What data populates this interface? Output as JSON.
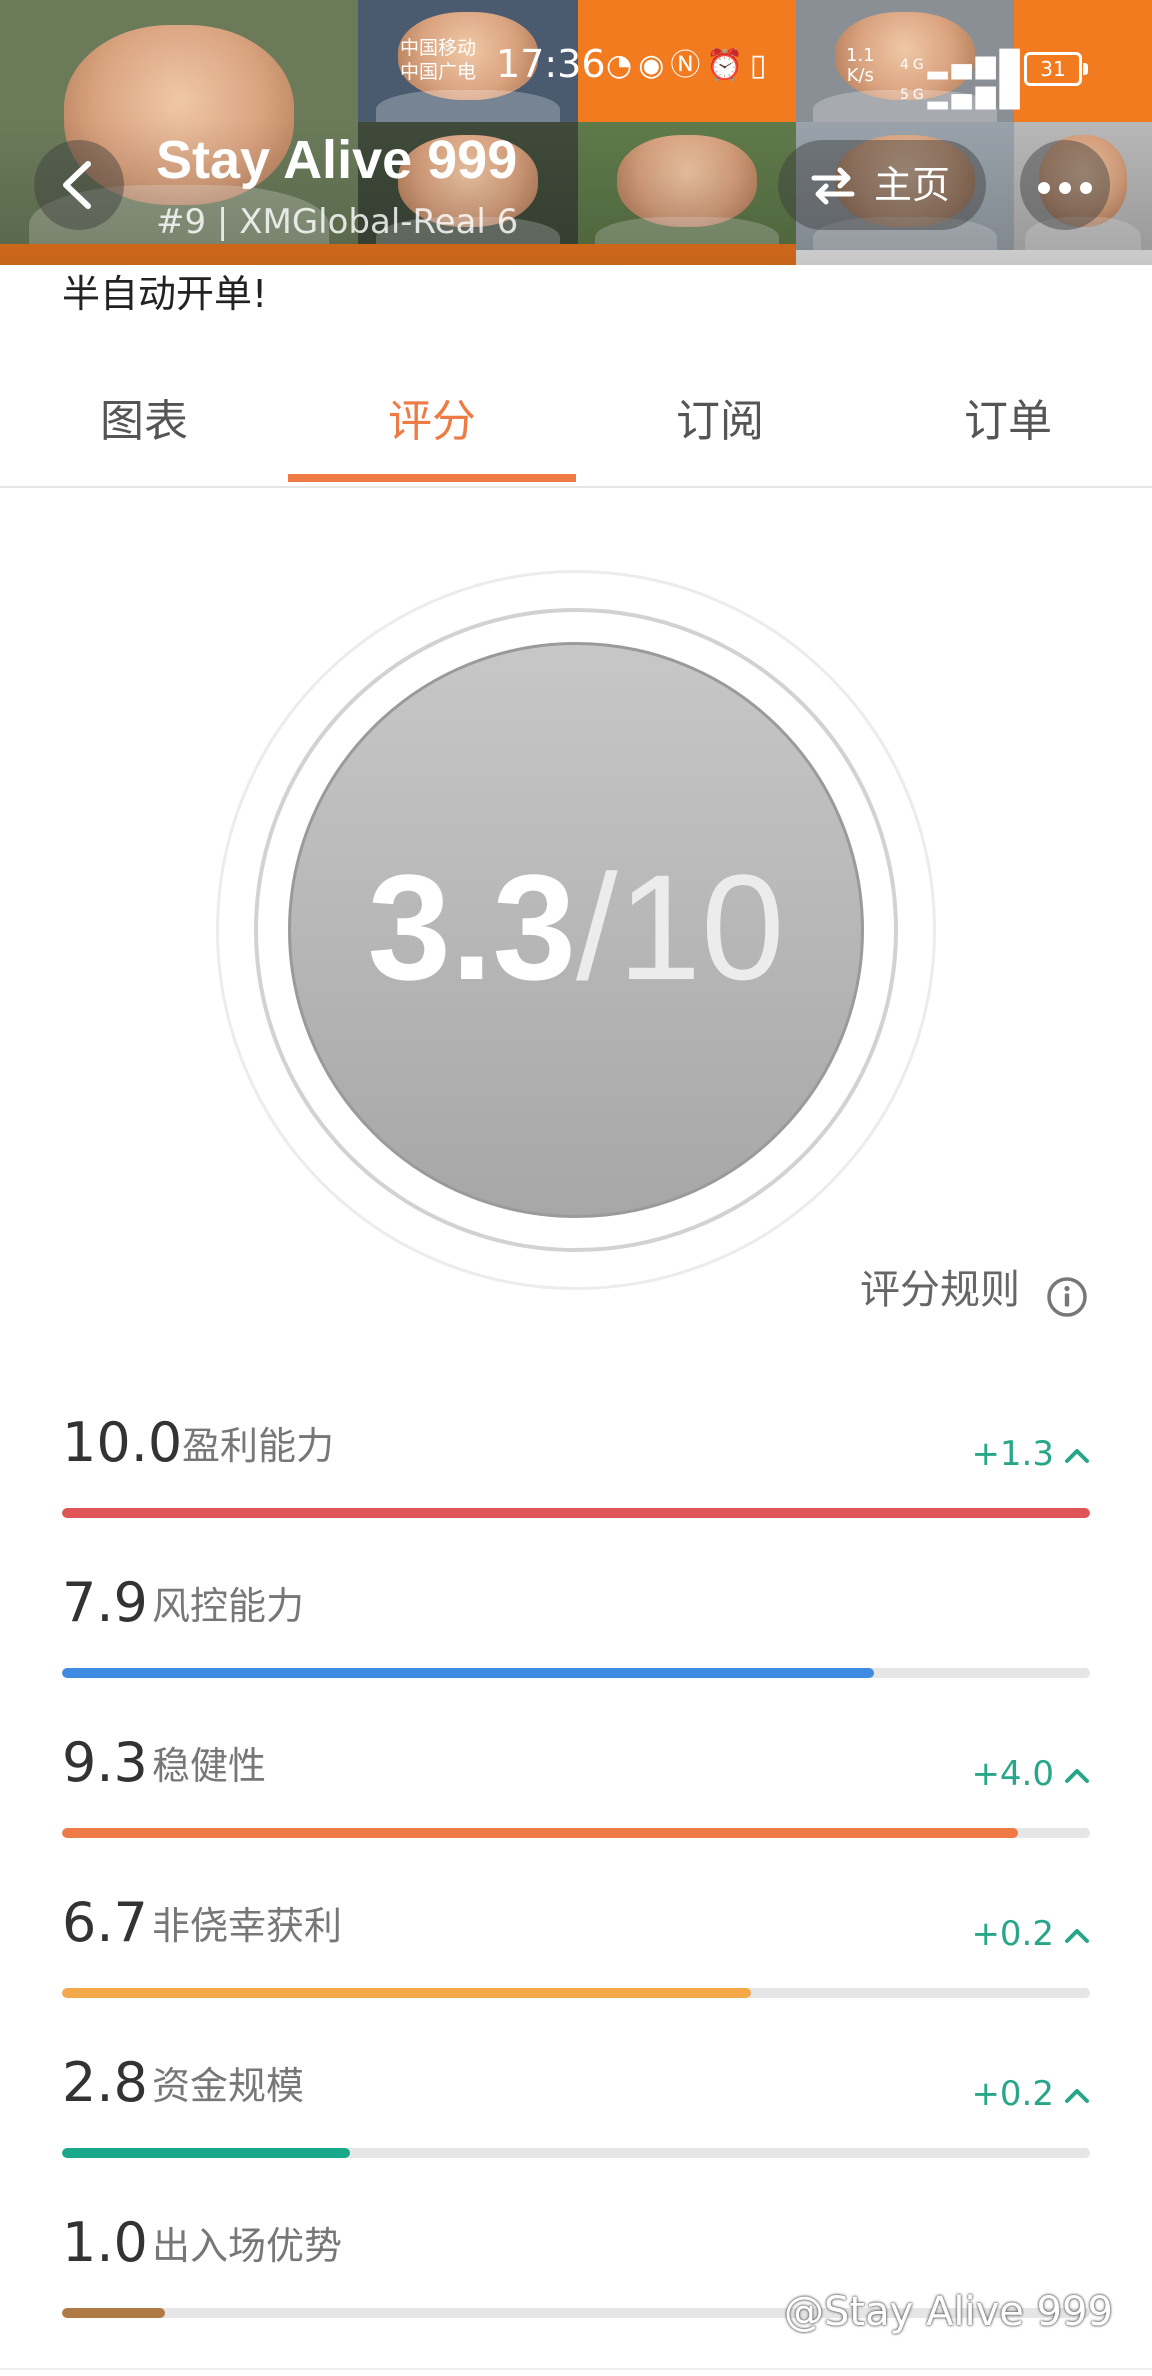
{
  "status_bar": {
    "carrier_1": "中国移动",
    "carrier_2": "中国广电",
    "time": "17:36",
    "net_speed_value": "1.1",
    "net_speed_unit": "K/s",
    "signal_1": "4G",
    "signal_2": "5G",
    "battery": "31"
  },
  "header": {
    "title": "Stay Alive 999",
    "subtitle": "#9 | XMGlobal-Real 6",
    "home_label": "主页"
  },
  "description": "半自动开单!",
  "tabs": [
    {
      "label": "图表",
      "active": false
    },
    {
      "label": "评分",
      "active": true
    },
    {
      "label": "订阅",
      "active": false
    },
    {
      "label": "订单",
      "active": false
    }
  ],
  "score": {
    "value": "3.3",
    "separator": "/",
    "max": "10",
    "rules_label": "评分规则"
  },
  "metrics": [
    {
      "value": "10.0",
      "label": "盈利能力",
      "delta": "+1.3",
      "fraction": 1.0,
      "color": "#df5557"
    },
    {
      "value": "7.9",
      "label": "风控能力",
      "delta": "",
      "fraction": 0.79,
      "color": "#3f8be2"
    },
    {
      "value": "9.3",
      "label": "稳健性",
      "delta": "+4.0",
      "fraction": 0.93,
      "color": "#ee7b45"
    },
    {
      "value": "6.7",
      "label": "非侥幸获利",
      "delta": "+0.2",
      "fraction": 0.67,
      "color": "#f3a84a"
    },
    {
      "value": "2.8",
      "label": "资金规模",
      "delta": "+0.2",
      "fraction": 0.28,
      "color": "#19a88a"
    },
    {
      "value": "1.0",
      "label": "出入场优势",
      "delta": "",
      "fraction": 0.1,
      "color": "#b07a45"
    }
  ],
  "watermark": "@Stay Alive 999",
  "colors": {
    "accent": "#ee7a44",
    "delta_green": "#28a68a",
    "banner_orange": "#f07b2a"
  }
}
